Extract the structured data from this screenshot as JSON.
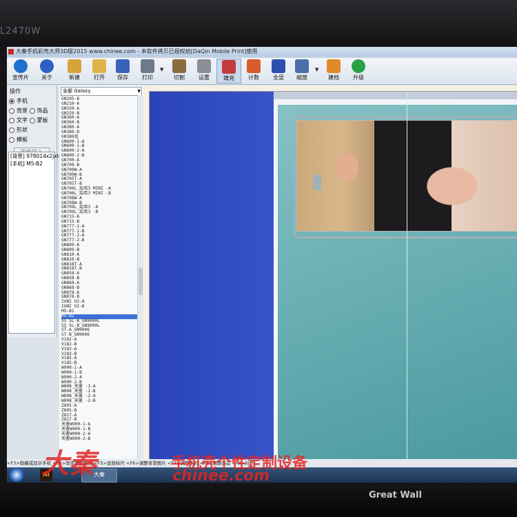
{
  "monitor": {
    "model_label": "L2470W",
    "brand": "Great Wall"
  },
  "window": {
    "title": "大秦手机彩壳大师3D版2015 www.chinee.com - 本软件拷贝已授权给[DaQin Mobile Print]使用"
  },
  "toolbar": {
    "buttons": [
      {
        "label": "宣传片",
        "color": "#1f6fd1"
      },
      {
        "label": "关于",
        "color": "#2f5fc4"
      },
      {
        "label": "新建",
        "color": "#d7a43a"
      },
      {
        "label": "打开",
        "color": "#e0b447"
      },
      {
        "label": "保存",
        "color": "#3a62b8"
      },
      {
        "label": "打印",
        "color": "#6c7a8b"
      },
      {
        "label": "切割",
        "color": "#8c6b3f"
      },
      {
        "label": "设置",
        "color": "#8a8f95"
      },
      {
        "label": "填充",
        "color": "#c43b3b"
      },
      {
        "label": "计数",
        "color": "#d85c2c"
      },
      {
        "label": "全显",
        "color": "#2c4fb0"
      },
      {
        "label": "缩放",
        "color": "#4b6fa8"
      },
      {
        "label": "建档",
        "color": "#e08a27"
      },
      {
        "label": "升级",
        "color": "#27a344"
      }
    ]
  },
  "ops_panel": {
    "heading": "操作",
    "options": [
      {
        "label": "手机",
        "selected": true
      },
      {
        "label": "背景",
        "selected": false
      },
      {
        "label": "饰品",
        "selected": false
      },
      {
        "label": "文字",
        "selected": false
      },
      {
        "label": "蒙板",
        "selected": false
      },
      {
        "label": "形状",
        "selected": false
      },
      {
        "label": "模板",
        "selected": false
      }
    ],
    "input_button": "图像输入",
    "list_items": [
      "[背景] 978014x2jxl4c",
      "[手机] M5-B2"
    ]
  },
  "model_panel": {
    "combo": "全部 Galaxy",
    "items": [
      "GN205-B",
      "GN210-A",
      "GN320-A",
      "GN320-B",
      "GN360-A",
      "GN360-B",
      "GN380-A",
      "GN380-B",
      "GN380克",
      "GN600-1-A",
      "GN600-1-B",
      "GN600-2-A",
      "GN600-2-B",
      "GN700-A",
      "GN700-B",
      "GN700W-A",
      "GN700W-B",
      "GN705T-A",
      "GN705T-B",
      "GN706L_乱哈3 MINI -A",
      "GN706L_乱哈3 MINI -B",
      "GN708W-A",
      "GN708W-B",
      "GN709L_乱哈3 -A",
      "GN709L_乱哈3 -B",
      "GN715-A",
      "GN715-B",
      "GN777-1-A",
      "GN777-1-B",
      "GN777-2-A",
      "GN777-2-B",
      "GN800-A",
      "GN800-B",
      "GN810-A",
      "GN810-B",
      "GN818T-A",
      "GN818T-B",
      "GN858-A",
      "GN858-B",
      "GN868-A",
      "GN868-B",
      "GN878-A",
      "GN878-B",
      "IUNI U2-A",
      "IUNI U2-B",
      "M5-B1",
      "M5-B2",
      "S5 5L-A_GN9000L",
      "S5 5L-B_GN9000L",
      "ST-A_GN9006",
      "ST-B_GN9006",
      "V182-A",
      "V182-B",
      "V183-A",
      "V183-B",
      "V185-A",
      "V185-B",
      "W900-1-A",
      "W900-1-B",
      "W900-2-A",
      "W900-2-B",
      "W808_天鉴 -1-A",
      "W808_天鉴 -1-B",
      "W808_天鉴 -2-A",
      "W808_天鉴 -2-B",
      "Z805-A",
      "Z805-B",
      "Z817-A",
      "Z817-B",
      "天鉴W900-1-A",
      "天鉴W900-1-B",
      "天鉴W900-2-A",
      "天鉴W900-2-B"
    ],
    "selected": "M5-B2"
  },
  "status": {
    "text": "<F3>隐藏或显示手机 <F4>改变蒙版颜色 <F5>显隐标尺 <F6>调整背景图片 <F7>调整手机 <F8>调整饰品 <F9>对齐"
  },
  "taskbar": {
    "app_label": "大秦",
    "ai_label": "Ai"
  },
  "watermark": {
    "logo": "大秦",
    "slogan": "手机壳个性定制设备",
    "url": "chinee.com"
  }
}
